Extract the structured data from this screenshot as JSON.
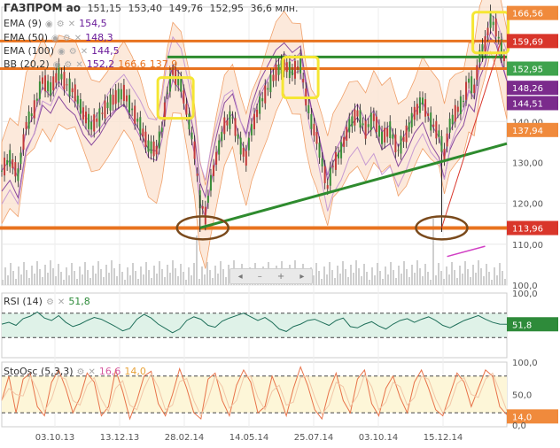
{
  "header": {
    "symbol": "ГАЗПРОМ ао",
    "open": "151,15",
    "high": "153,40",
    "low": "149,76",
    "close": "152,95",
    "volume": "36,6 млн."
  },
  "indicators": {
    "ema9": {
      "label": "EMA (9)",
      "value": "154,5",
      "color": "#6a1b9a"
    },
    "ema50": {
      "label": "EMA (50)",
      "value": "148,3",
      "color": "#6a1b9a"
    },
    "ema100": {
      "label": "EMA (100)",
      "value": "144,5",
      "color": "#6a1b9a"
    },
    "bb": {
      "label": "BB (20,2)",
      "mid": "152,2",
      "upper": "166,6",
      "lower": "137,9",
      "color": "#e8731f"
    },
    "rsi": {
      "label": "RSI (14)",
      "value": "51,8"
    },
    "sto": {
      "label": "StoOsc (5,3,3)",
      "k": "16,6",
      "d": "14,0"
    }
  },
  "price_tags": [
    {
      "text": "166,56",
      "color": "#f08a3c",
      "price": 166.56
    },
    {
      "text": "159,69",
      "color": "#d9362b",
      "price": 159.69
    },
    {
      "text": "152,95",
      "color": "#3fa34d",
      "price": 152.95
    },
    {
      "text": "148,26",
      "color": "#7b2b8c",
      "price": 148.26
    },
    {
      "text": "144,51",
      "color": "#7b2b8c",
      "price": 144.51
    },
    {
      "text": "137,94",
      "color": "#f08a3c",
      "price": 137.94
    },
    {
      "text": "113,96",
      "color": "#d9362b",
      "price": 113.96
    }
  ],
  "rsi_tag": {
    "text": "51,8",
    "color": "#2e8b3a"
  },
  "sto_tag": {
    "text": "14,0",
    "color": "#f08a3c"
  },
  "nav_buttons": [
    "◂",
    "–",
    "+",
    "▸"
  ],
  "chart_data": {
    "type": "line",
    "x_dates": [
      "03.10.13",
      "13.12.13",
      "28.02.14",
      "14.05.14",
      "25.07.14",
      "03.10.14",
      "15.12.14"
    ],
    "price_ticks": [
      "140,00",
      "130,00",
      "120,00",
      "110,00",
      "100,0"
    ],
    "price_tick_values": [
      140,
      130,
      120,
      110,
      100
    ],
    "rsi_ticks": [
      "100,0"
    ],
    "sto_ticks": [
      "100,0",
      "50,0",
      "0,0"
    ],
    "ylim": [
      100,
      168
    ],
    "price_series": [
      [
        0,
        128
      ],
      [
        3,
        131
      ],
      [
        6,
        127
      ],
      [
        9,
        139
      ],
      [
        12,
        143
      ],
      [
        15,
        150
      ],
      [
        18,
        148
      ],
      [
        21,
        152
      ],
      [
        24,
        149
      ],
      [
        27,
        147
      ],
      [
        30,
        142
      ],
      [
        33,
        139
      ],
      [
        36,
        141
      ],
      [
        39,
        144
      ],
      [
        42,
        146
      ],
      [
        45,
        147
      ],
      [
        48,
        143
      ],
      [
        51,
        139
      ],
      [
        54,
        134
      ],
      [
        57,
        133
      ],
      [
        59,
        138
      ],
      [
        61,
        147
      ],
      [
        63,
        152
      ],
      [
        66,
        149
      ],
      [
        69,
        140
      ],
      [
        71,
        133
      ],
      [
        73,
        121
      ],
      [
        75,
        117
      ],
      [
        77,
        125
      ],
      [
        79,
        131
      ],
      [
        82,
        139
      ],
      [
        85,
        141
      ],
      [
        88,
        134
      ],
      [
        90,
        131
      ],
      [
        92,
        138
      ],
      [
        95,
        144
      ],
      [
        98,
        148
      ],
      [
        101,
        152
      ],
      [
        104,
        154
      ],
      [
        107,
        152
      ],
      [
        110,
        154
      ],
      [
        112,
        146
      ],
      [
        114,
        140
      ],
      [
        116,
        136
      ],
      [
        118,
        130
      ],
      [
        120,
        124
      ],
      [
        122,
        129
      ],
      [
        125,
        133
      ],
      [
        128,
        139
      ],
      [
        131,
        142
      ],
      [
        134,
        138
      ],
      [
        137,
        141
      ],
      [
        140,
        136
      ],
      [
        143,
        138
      ],
      [
        146,
        133
      ],
      [
        149,
        137
      ],
      [
        152,
        142
      ],
      [
        155,
        145
      ],
      [
        158,
        140
      ],
      [
        161,
        137
      ],
      [
        163,
        132
      ],
      [
        165,
        139
      ],
      [
        167,
        142
      ],
      [
        170,
        145
      ],
      [
        172,
        150
      ],
      [
        174,
        148
      ],
      [
        176,
        156
      ],
      [
        178,
        159
      ],
      [
        180,
        165
      ],
      [
        182,
        163
      ],
      [
        184,
        158
      ],
      [
        186,
        153
      ]
    ],
    "x_range": [
      0,
      186
    ],
    "h_levels": [
      {
        "price": 159.69,
        "color": "#e8731f",
        "width": 3
      },
      {
        "price": 152.95,
        "color": "#e8731f",
        "width": 3
      },
      {
        "price": 113.96,
        "color": "#e8731f",
        "width": 4
      }
    ],
    "green_level": 155.8,
    "trend_lines": [
      {
        "from": [
          73,
          114
        ],
        "to": [
          186,
          134.6
        ],
        "color": "#2e8b2e",
        "width": 3
      },
      {
        "from": [
          162,
          114
        ],
        "to": [
          184,
          160
        ],
        "color": "#d9362b",
        "width": 1
      }
    ],
    "yellow_boxes": [
      [
        64,
        146
      ],
      [
        110,
        151
      ],
      [
        180,
        162
      ]
    ],
    "brown_ellipses": [
      [
        74,
        114
      ],
      [
        162,
        114
      ]
    ],
    "rsi_series": [
      52,
      55,
      50,
      61,
      65,
      72,
      62,
      58,
      66,
      55,
      48,
      52,
      58,
      63,
      60,
      54,
      48,
      41,
      45,
      60,
      68,
      62,
      52,
      45,
      38,
      44,
      58,
      64,
      60,
      50,
      47,
      57,
      62,
      66,
      70,
      64,
      58,
      63,
      55,
      44,
      40,
      48,
      52,
      58,
      60,
      55,
      50,
      58,
      62,
      48,
      46,
      52,
      56,
      49,
      44,
      52,
      58,
      61,
      55,
      60,
      64,
      58,
      50,
      46,
      52,
      58,
      62,
      66,
      60,
      55,
      52,
      51.8
    ],
    "sto_series": [
      40,
      80,
      20,
      75,
      85,
      30,
      15,
      70,
      90,
      60,
      20,
      45,
      85,
      70,
      15,
      30,
      90,
      55,
      10,
      40,
      80,
      88,
      35,
      15,
      50,
      92,
      60,
      20,
      10,
      75,
      85,
      40,
      15,
      65,
      90,
      70,
      20,
      30,
      80,
      50,
      15,
      60,
      95,
      65,
      25,
      10,
      55,
      85,
      40,
      20,
      75,
      90,
      35,
      15,
      60,
      80,
      45,
      20,
      70,
      90,
      60,
      25,
      15,
      50,
      85,
      70,
      30,
      60,
      90,
      80,
      30,
      16.6
    ]
  }
}
